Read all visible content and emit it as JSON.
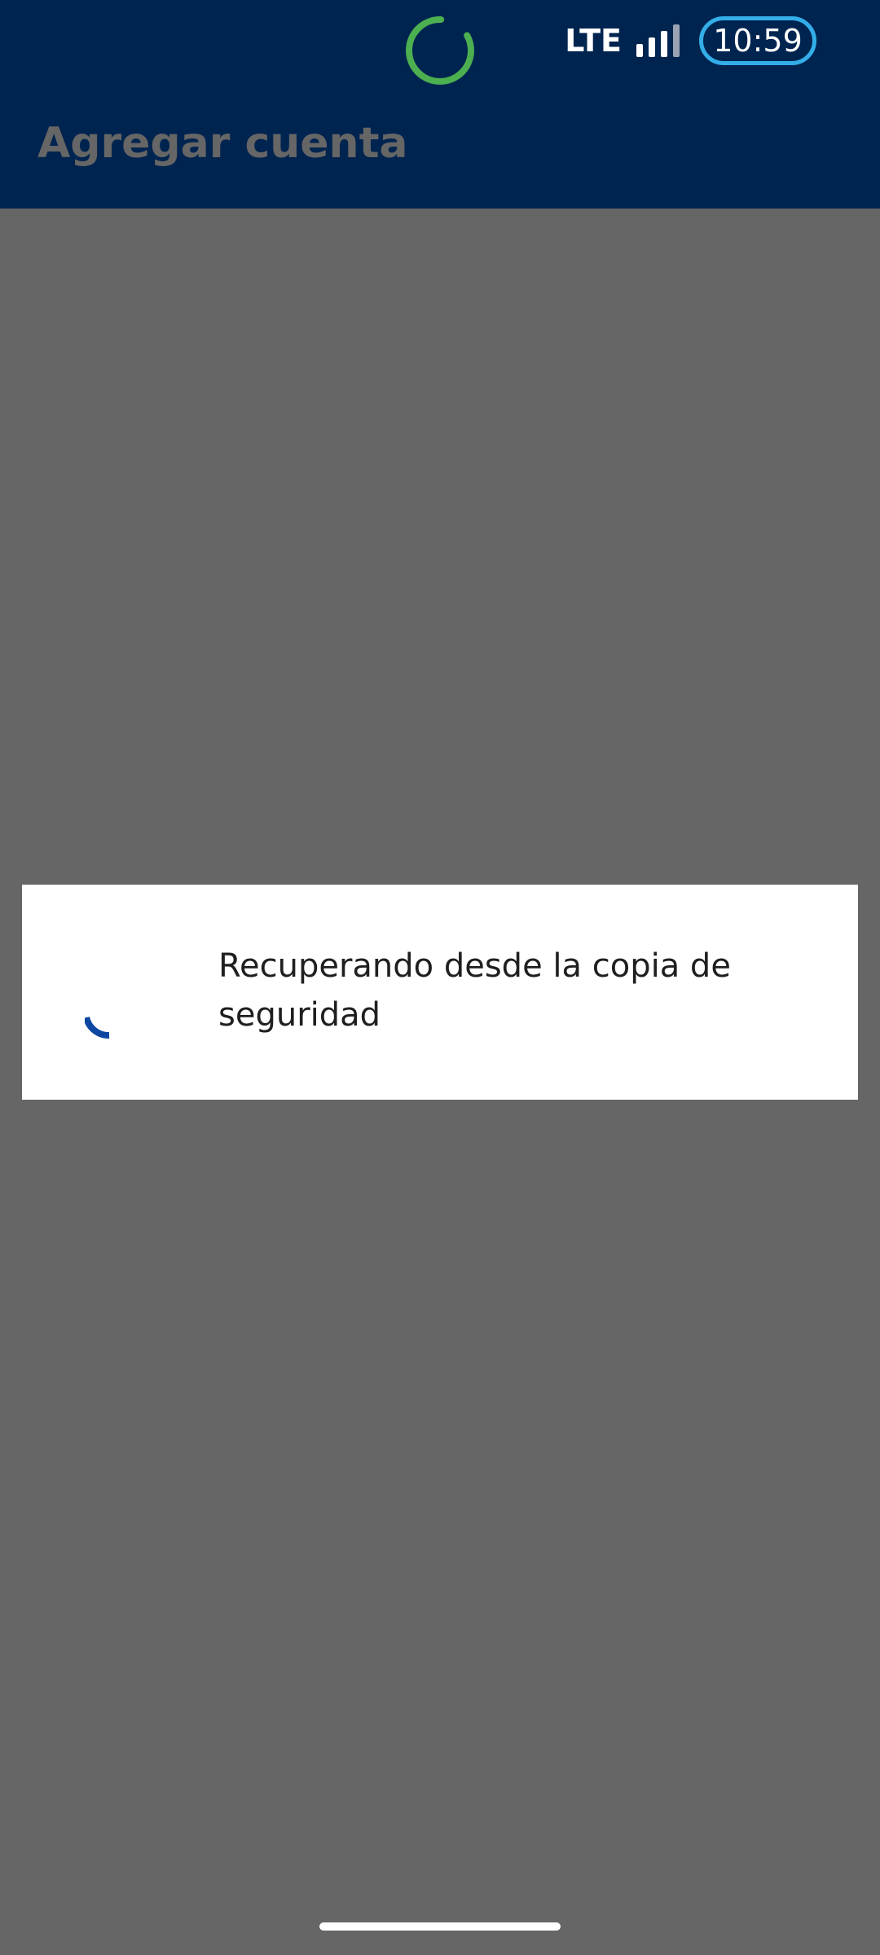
{
  "status_bar": {
    "network": "LTE",
    "time": "10:59",
    "icons": {
      "center": "sync-ring-icon",
      "signal": "signal-strength-icon"
    },
    "colors": {
      "ring": "#4caf50",
      "time_pill_border": "#33aee8"
    }
  },
  "header": {
    "title": "Agregar cuenta"
  },
  "dialog": {
    "message": "Recuperando desde la copia de seguridad",
    "spinner_icon": "loading-spinner-icon",
    "spinner_color": "#0d47a1"
  },
  "colors": {
    "app_bar": "#002450",
    "scrim": "#666666",
    "dialog_bg": "#ffffff",
    "text": "#1f1f1f"
  }
}
